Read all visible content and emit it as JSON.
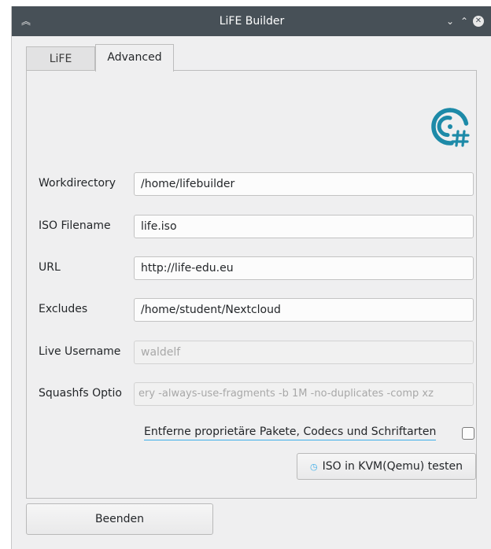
{
  "window": {
    "title": "LiFE Builder"
  },
  "tabs": [
    {
      "label": "LiFE"
    },
    {
      "label": "Advanced"
    }
  ],
  "form": {
    "workdirectory": {
      "label": "Workdirectory",
      "value": "/home/lifebuilder"
    },
    "iso_filename": {
      "label": "ISO Filename",
      "value": "life.iso"
    },
    "url": {
      "label": "URL",
      "value": "http://life-edu.eu"
    },
    "excludes": {
      "label": "Excludes",
      "value": "/home/student/Nextcloud"
    },
    "live_username": {
      "label": "Live Username",
      "value": "waldelf"
    },
    "squashfs_options": {
      "label": "Squashfs Optio",
      "value": "ery -always-use-fragments -b 1M -no-duplicates -comp xz"
    }
  },
  "remove_proprietary": {
    "label": "Entferne proprietäre Pakete, Codecs und Schriftarten",
    "checked": false
  },
  "buttons": {
    "test_iso": "ISO in KVM(Qemu) testen",
    "quit": "Beenden"
  },
  "colors": {
    "titlebar": "#475057",
    "accent": "#3daee9",
    "logo": "#1d8aa8"
  },
  "icons": {
    "logo": "disc-hash-icon",
    "test": "refresh-icon"
  }
}
